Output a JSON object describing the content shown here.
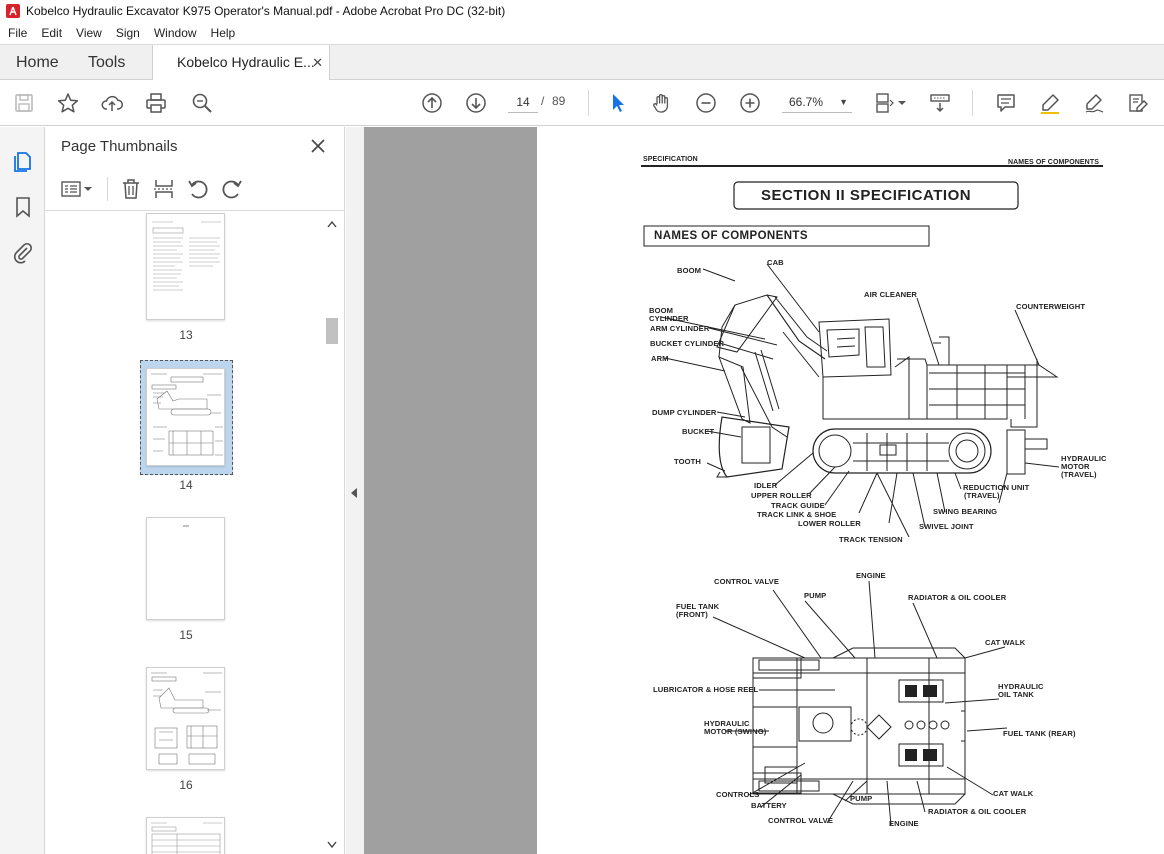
{
  "window": {
    "title": "Kobelco Hydraulic Excavator K975 Operator's Manual.pdf - Adobe Acrobat Pro DC (32-bit)"
  },
  "menu": [
    "File",
    "Edit",
    "View",
    "Sign",
    "Window",
    "Help"
  ],
  "tabs": {
    "home": "Home",
    "tools": "Tools",
    "document": "Kobelco Hydraulic E...",
    "close_glyph": "✕"
  },
  "toolbar": {
    "current_page": "14",
    "page_separator": "/",
    "total_pages": "89",
    "zoom": "66.7%"
  },
  "panel": {
    "title": "Page Thumbnails",
    "thumbnails": [
      {
        "page": "13"
      },
      {
        "page": "14",
        "selected": true
      },
      {
        "page": "15"
      },
      {
        "page": "16"
      }
    ]
  },
  "document": {
    "header_left": "SPECIFICATION",
    "header_right": "NAMES OF COMPONENTS",
    "section_title": "SECTION II  SPECIFICATION",
    "subsection_title": "NAMES OF COMPONENTS",
    "side_view_labels": {
      "cab": "CAB",
      "boom": "BOOM",
      "air_cleaner": "AIR CLEANER",
      "counterweight": "COUNTERWEIGHT",
      "boom_cylinder_1": "BOOM",
      "boom_cylinder_2": "CYLINDER",
      "arm_cylinder": "ARM CYLINDER",
      "bucket_cylinder": "BUCKET CYLINDER",
      "arm": "ARM",
      "dump_cylinder": "DUMP CYLINDER",
      "bucket": "BUCKET",
      "tooth": "TOOTH",
      "idler": "IDLER",
      "upper_roller": "UPPER ROLLER",
      "track_guide": "TRACK GUIDE",
      "track_link_shoe": "TRACK LINK & SHOE",
      "lower_roller": "LOWER ROLLER",
      "track_tension": "TRACK TENSION",
      "swivel_joint": "SWIVEL JOINT",
      "swing_bearing": "SWING BEARING",
      "reduction_unit_1": "REDUCTION UNIT",
      "reduction_unit_2": "(TRAVEL)",
      "hyd_motor_1": "HYDRAULIC",
      "hyd_motor_2": "MOTOR",
      "hyd_motor_3": "(TRAVEL)"
    },
    "top_view_labels": {
      "control_valve_top": "CONTROL VALVE",
      "engine_top": "ENGINE",
      "pump_top": "PUMP",
      "radiator_top": "RADIATOR & OIL COOLER",
      "fuel_tank_front_1": "FUEL TANK",
      "fuel_tank_front_2": "(FRONT)",
      "cat_walk_top": "CAT WALK",
      "lubricator": "LUBRICATOR & HOSE REEL",
      "hyd_oil_tank_1": "HYDRAULIC",
      "hyd_oil_tank_2": "OIL TANK",
      "hyd_motor_swing_1": "HYDRAULIC",
      "hyd_motor_swing_2": "MOTOR (SWING)",
      "fuel_tank_rear": "FUEL TANK (REAR)",
      "controls": "CONTROLS",
      "battery": "BATTERY",
      "pump_bottom": "PUMP",
      "cat_walk_bottom": "CAT WALK",
      "radiator_bottom": "RADIATOR & OIL COOLER",
      "control_valve_bottom": "CONTROL VALVE",
      "engine_bottom": "ENGINE"
    }
  },
  "colors": {
    "accent": "#1473e6",
    "tab_bg": "#f0f0f0",
    "doc_bg": "#a0a0a0",
    "selection": "#bdd6ee"
  }
}
